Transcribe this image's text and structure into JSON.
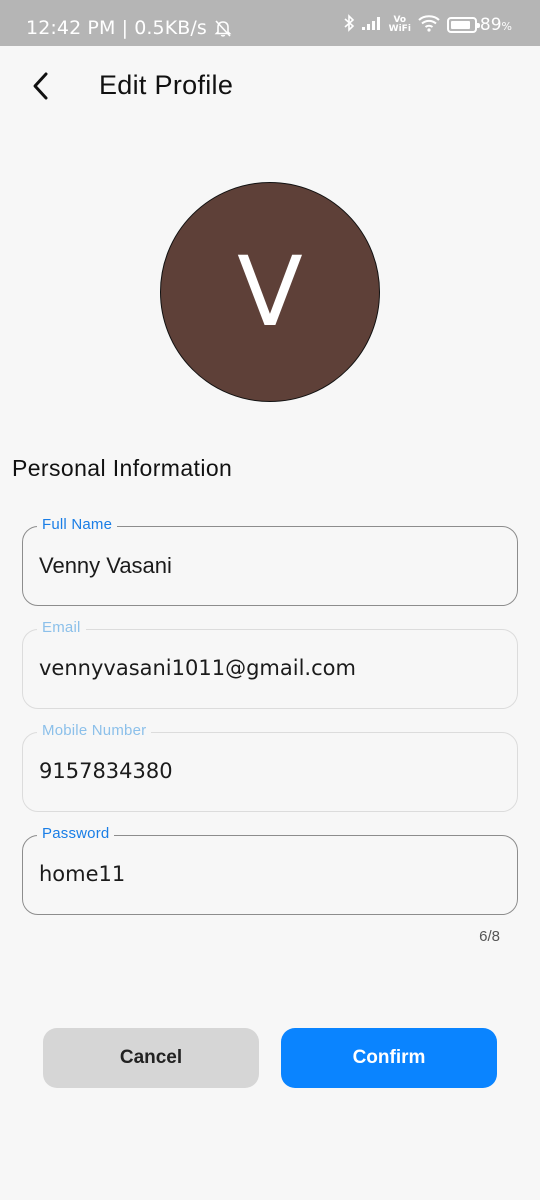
{
  "status_bar": {
    "time_speed": "12:42 PM | 0.5KB/s",
    "volte_top": "Vo",
    "volte_bottom": "WiFi",
    "battery_level": 0.89,
    "battery_text": "89",
    "battery_unit": "%"
  },
  "header": {
    "title": "Edit Profile"
  },
  "avatar": {
    "initial": "V",
    "color": "#5e4038"
  },
  "section": {
    "title": "Personal Information"
  },
  "fields": {
    "full_name": {
      "label": "Full Name",
      "value": "Venny Vasani"
    },
    "email": {
      "label": "Email",
      "value": "vennyvasani1011@gmail.com"
    },
    "mobile": {
      "label": "Mobile Number",
      "value": "9157834380"
    },
    "password": {
      "label": "Password",
      "value": "home11",
      "counter": "6/8"
    }
  },
  "buttons": {
    "cancel": "Cancel",
    "confirm": "Confirm"
  },
  "colors": {
    "accent": "#0a84ff",
    "label_active": "#1a7ee6",
    "label_disabled": "#8cc0ea"
  }
}
